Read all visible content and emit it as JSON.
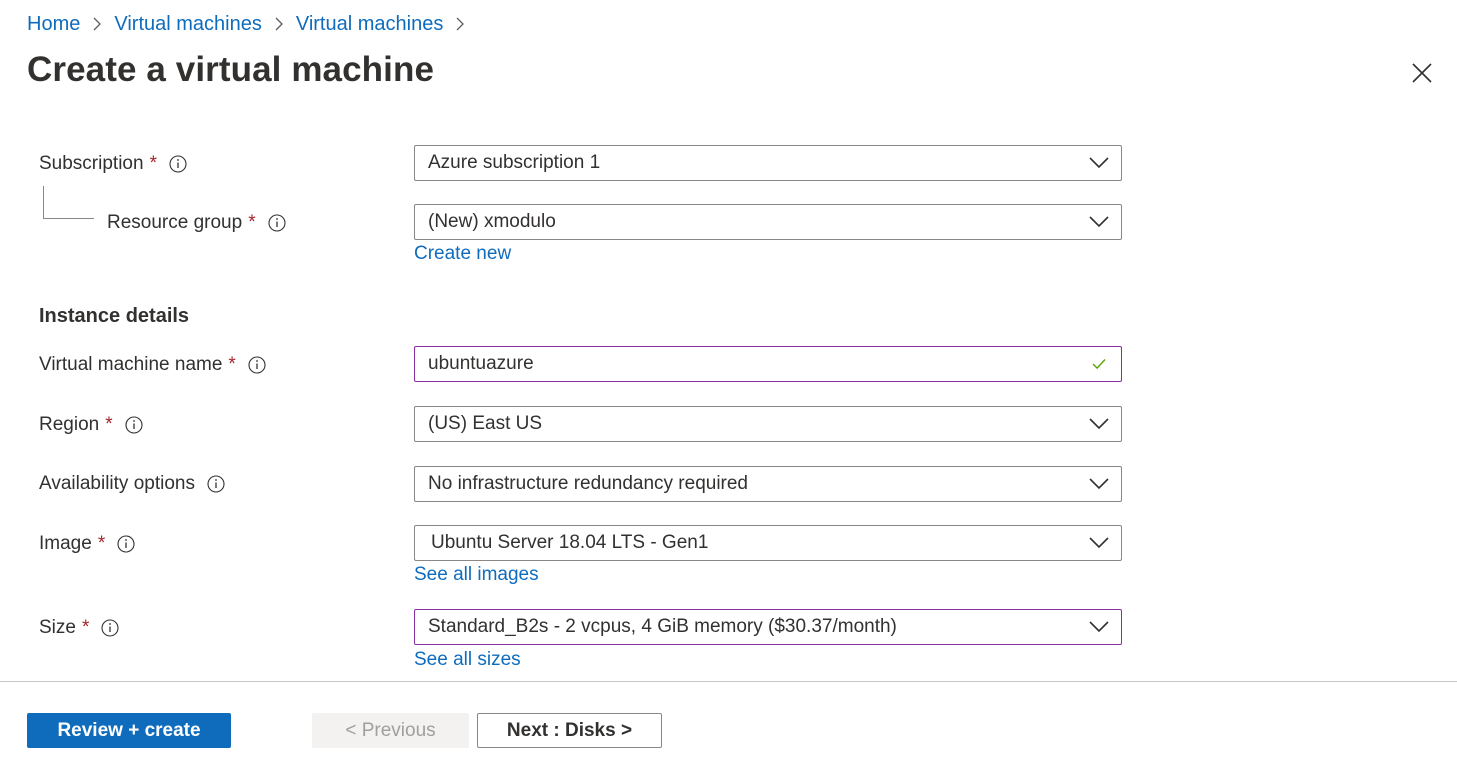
{
  "breadcrumb": [
    "Home",
    "Virtual machines",
    "Virtual machines"
  ],
  "page_title": "Create a virtual machine",
  "form": {
    "subscription": {
      "label": "Subscription",
      "required": "*",
      "value": "Azure subscription 1"
    },
    "resource_group": {
      "label": "Resource group",
      "required": "*",
      "value": "(New) xmodulo",
      "link": "Create new"
    },
    "instance_details_heading": "Instance details",
    "vm_name": {
      "label": "Virtual machine name",
      "required": "*",
      "value": "ubuntuazure",
      "valid": true
    },
    "region": {
      "label": "Region",
      "required": "*",
      "value": "(US) East US"
    },
    "availability": {
      "label": "Availability options",
      "value": "No infrastructure redundancy required"
    },
    "image": {
      "label": "Image",
      "required": "*",
      "value": "Ubuntu Server 18.04 LTS - Gen1",
      "link": "See all images"
    },
    "size": {
      "label": "Size",
      "required": "*",
      "value": "Standard_B2s - 2 vcpus, 4 GiB memory ($30.37/month)",
      "link": "See all sizes"
    }
  },
  "footer": {
    "review_create": "Review + create",
    "previous": "< Previous",
    "next": "Next : Disks >"
  },
  "colors": {
    "accent": "#0f6cbd",
    "required": "#a4262c",
    "focus_border": "#8a2da5",
    "valid_check": "#57a300"
  }
}
